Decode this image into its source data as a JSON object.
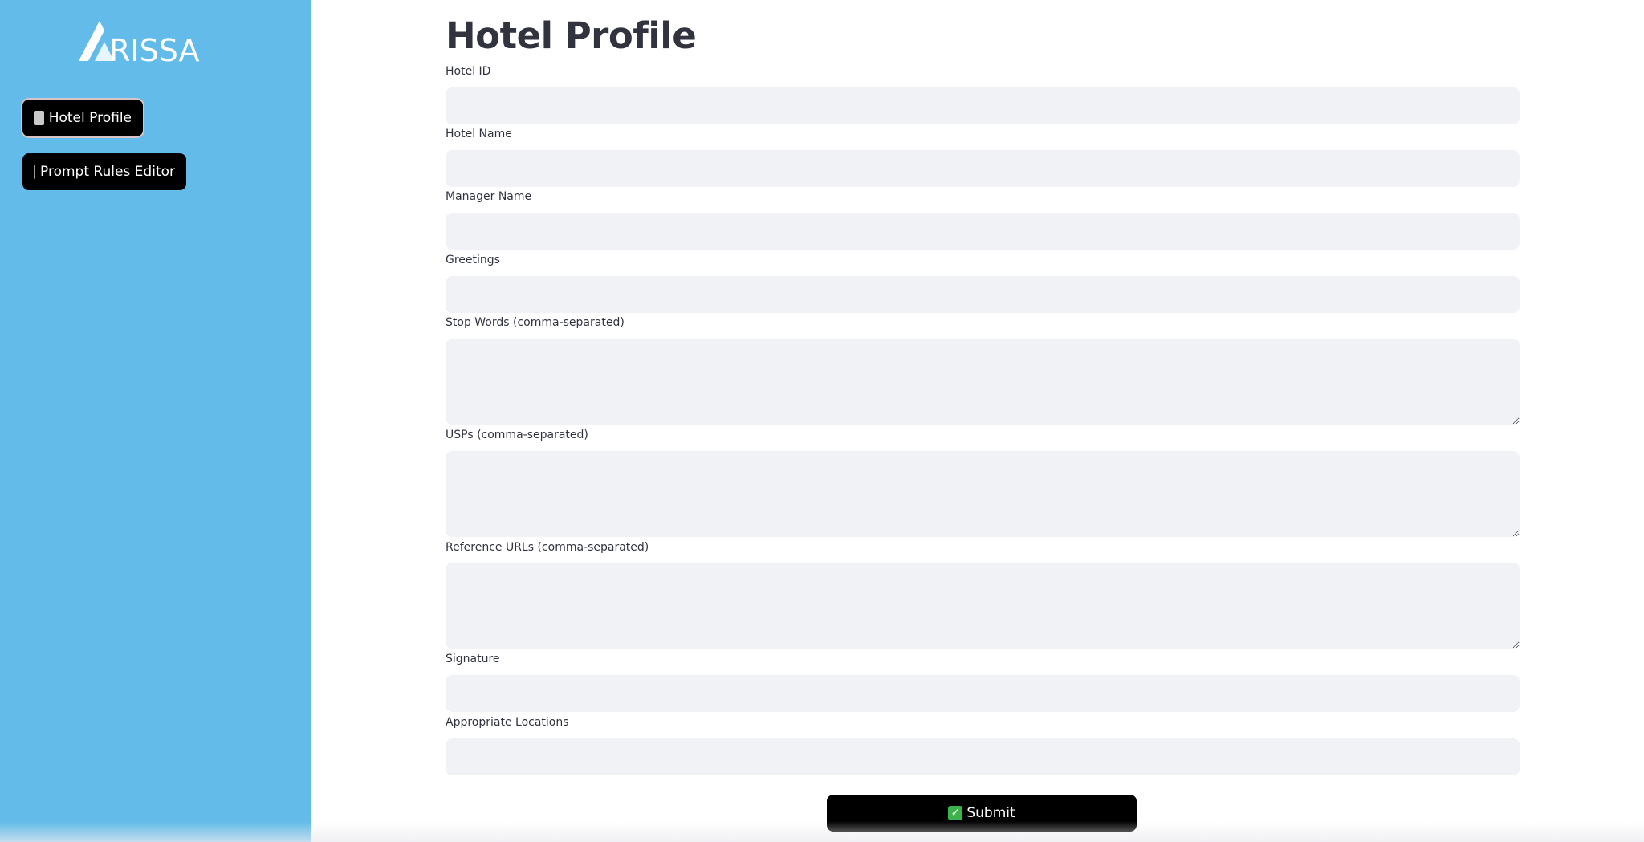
{
  "app": {
    "logo_text": "ARISSA"
  },
  "sidebar": {
    "items": [
      {
        "label": "Hotel Profile",
        "icon": "hotel-icon",
        "active": true
      },
      {
        "label": "Prompt Rules Editor",
        "icon": "memo-icon",
        "active": false
      }
    ]
  },
  "main": {
    "title": "Hotel Profile",
    "fields": [
      {
        "label": "Hotel ID",
        "value": "",
        "type": "input"
      },
      {
        "label": "Hotel Name",
        "value": "",
        "type": "input"
      },
      {
        "label": "Manager Name",
        "value": "",
        "type": "input"
      },
      {
        "label": "Greetings",
        "value": "",
        "type": "input"
      },
      {
        "label": "Stop Words (comma-separated)",
        "value": "",
        "type": "textarea"
      },
      {
        "label": "USPs (comma-separated)",
        "value": "",
        "type": "textarea"
      },
      {
        "label": "Reference URLs (comma-separated)",
        "value": "",
        "type": "textarea"
      },
      {
        "label": "Signature",
        "value": "",
        "type": "input"
      },
      {
        "label": "Appropriate Locations",
        "value": "",
        "type": "input"
      }
    ],
    "submit_label": "Submit",
    "submit_icon": "check-icon"
  },
  "colors": {
    "sidebar_bg": "#62bbe8",
    "button_bg": "#000000",
    "field_bg": "#f0f2f6",
    "text": "#31333f"
  }
}
